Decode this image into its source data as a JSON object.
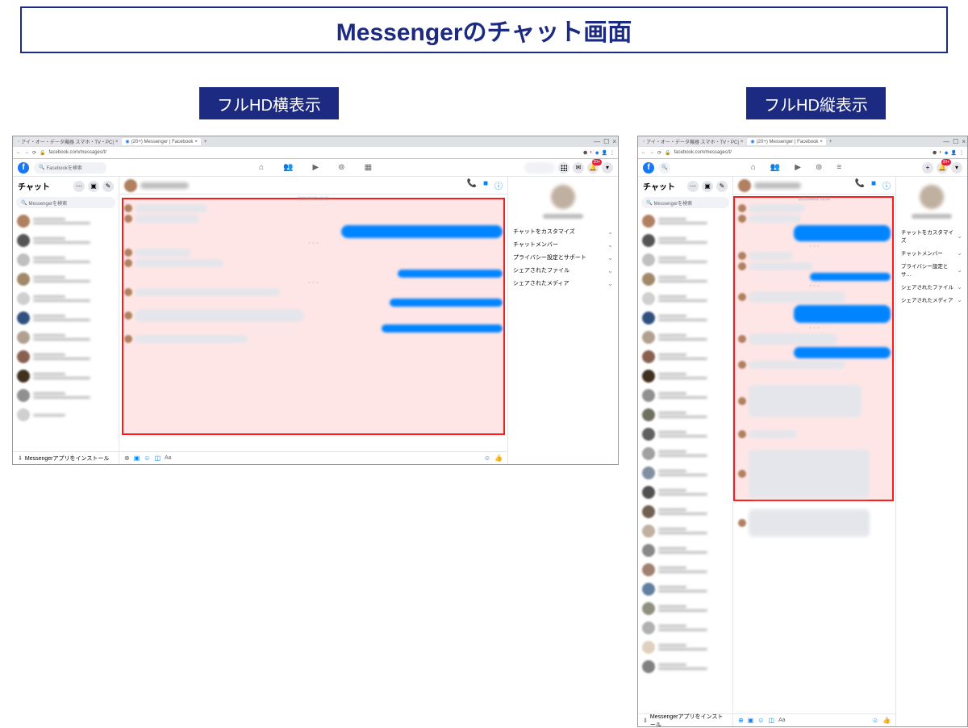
{
  "page_title": "Messengerのチャット画面",
  "labels": {
    "landscape": "フルHD横表示",
    "portrait": "フルHD縦表示"
  },
  "browser": {
    "tab1": "アイ・オー・データ機器 スマホ・TV・PC|",
    "tab2": "(20+) Messenger | Facebook",
    "url": "facebook.com/messages/t/",
    "badge": "20+"
  },
  "fb": {
    "search_placeholder": "Facebookを検索",
    "chat_title": "チャット",
    "messenger_search": "Messengerを検索",
    "install_app": "Messengerアプリをインストール",
    "timestamp": "2021/08/03 15:05"
  },
  "info_panel": {
    "items": [
      "チャットをカスタマイズ",
      "チャットメンバー",
      "プライバシー設定とサポート",
      "シェアされたファイル",
      "シェアされたメディア"
    ],
    "items_short": [
      "チャットをカスタマイズ",
      "チャットメンバー",
      "プライバシー設定とサ…",
      "シェアされたファイル",
      "シェアされたメディア"
    ]
  }
}
